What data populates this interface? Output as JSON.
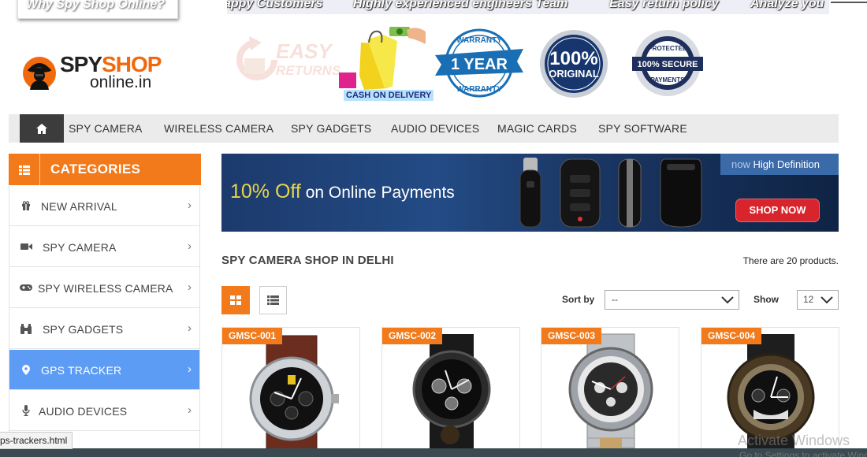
{
  "topbar": {
    "why_title": "Why Spy Shop Online?",
    "ticker": [
      "appy Customers",
      "Highly experienced engineers Team",
      "Easy return policy",
      "Analyze you"
    ]
  },
  "logo": {
    "brand_spy": "SPY",
    "brand_o": "S",
    "brand_hop": "HOP",
    "domain": "online.in"
  },
  "badges": {
    "easy_top": "EASY",
    "easy_bottom": "RETURNS",
    "cod_label": "CASH ON DELIVERY",
    "warranty_top": "WARRANTY",
    "warranty_mid": "1 YEAR",
    "warranty_bottom": "WARRANTY",
    "original_top": "100%",
    "original_bottom": "ORIGINAL",
    "secure_top": "PROTECTED",
    "secure_mid": "100% SECURE",
    "secure_bottom": "PAYMENTS"
  },
  "nav": {
    "items": [
      "SPY CAMERA",
      "WIRELESS CAMERA",
      "SPY GADGETS",
      "AUDIO DEVICES",
      "MAGIC CARDS",
      "SPY SOFTWARE"
    ]
  },
  "sidebar": {
    "title": "CATEGORIES",
    "items": [
      {
        "label": "NEW ARRIVAL",
        "icon": "gift-icon"
      },
      {
        "label": "SPY CAMERA",
        "icon": "video-camera-icon"
      },
      {
        "label": "SPY WIRELESS CAMERA",
        "icon": "gamepad-icon"
      },
      {
        "label": "SPY GADGETS",
        "icon": "binoculars-icon"
      },
      {
        "label": "GPS TRACKER",
        "icon": "map-pin-icon",
        "active": true
      },
      {
        "label": "AUDIO DEVICES",
        "icon": "microphone-icon"
      }
    ]
  },
  "banner": {
    "offer_highlight": "10% Off",
    "offer_rest": " on Online Payments",
    "hd_now": "now",
    "hd_text": " High Definition",
    "shop_now": "SHOP NOW"
  },
  "content": {
    "heading": "SPY CAMERA SHOP IN DELHI",
    "product_count": "There are 20 products.",
    "sort_label": "Sort by",
    "sort_value": "--",
    "show_label": "Show",
    "show_value": "12"
  },
  "products": [
    {
      "code": "GMSC-001"
    },
    {
      "code": "GMSC-002"
    },
    {
      "code": "GMSC-003"
    },
    {
      "code": "GMSC-004"
    }
  ],
  "status": {
    "url": "ps-trackers.html"
  },
  "watermark": {
    "line1": "Activate Windows",
    "line2": "Go to Settings to activate Windows."
  },
  "colors": {
    "accent": "#f27a1a",
    "active_blue": "#5c9cf4",
    "nav_bg": "#ebebeb"
  }
}
